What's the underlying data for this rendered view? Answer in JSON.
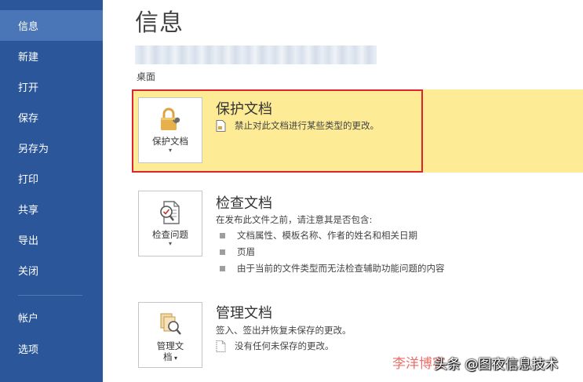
{
  "sidebar": {
    "items": [
      {
        "label": "信息",
        "active": true
      },
      {
        "label": "新建"
      },
      {
        "label": "打开"
      },
      {
        "label": "保存"
      },
      {
        "label": "另存为"
      },
      {
        "label": "打印"
      },
      {
        "label": "共享"
      },
      {
        "label": "导出"
      },
      {
        "label": "关闭"
      },
      {
        "label": "帐户"
      },
      {
        "label": "选项"
      }
    ]
  },
  "main": {
    "title": "信息",
    "path_label": "桌面",
    "protect": {
      "button_label": "保护文档",
      "title": "保护文档",
      "desc": "禁止对此文档进行某些类型的更改。"
    },
    "inspect": {
      "button_label": "检查问题",
      "title": "检查文档",
      "intro": "在发布此文件之前，请注意其是否包含:",
      "bullets": [
        "文档属性、模板名称、作者的姓名和相关日期",
        "页眉",
        "由于当前的文件类型而无法检查辅助功能问题的内容"
      ]
    },
    "manage": {
      "button_label_line1": "管理文",
      "button_label_line2": "档",
      "title": "管理文档",
      "desc": "签入、签出并恢复未保存的更改。",
      "note": "没有任何未保存的更改。"
    }
  },
  "watermark": {
    "left": "李洋博客",
    "right": "头条 @图夜信息技术"
  },
  "colors": {
    "sidebar": "#2b579a",
    "sidebar_active": "#4a76b8",
    "highlight": "#fdeb95",
    "highlight_border": "#e0242f"
  }
}
